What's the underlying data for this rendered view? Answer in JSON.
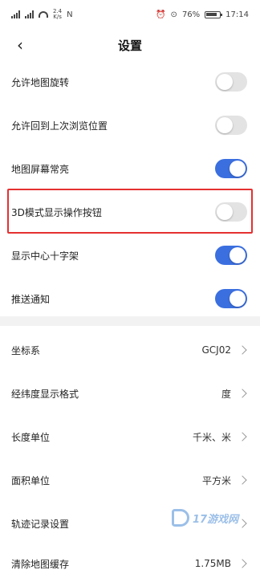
{
  "status_bar": {
    "net_speed_top": "2.4",
    "net_speed_bottom": "K/s",
    "battery": "76%",
    "time": "17:14",
    "icons": [
      "signal-icon",
      "wifi-icon",
      "nfc-icon",
      "alarm-icon",
      "location-icon",
      "battery-icon"
    ]
  },
  "header": {
    "title": "设置",
    "back_icon": "chevron-left-icon"
  },
  "toggles": [
    {
      "label": "允许地图旋转",
      "on": false
    },
    {
      "label": "允许回到上次浏览位置",
      "on": false
    },
    {
      "label": "地图屏幕常亮",
      "on": true
    },
    {
      "label": "3D模式显示操作按钮",
      "on": false
    },
    {
      "label": "显示中心十字架",
      "on": true
    },
    {
      "label": "推送通知",
      "on": true
    }
  ],
  "settings": [
    {
      "label": "坐标系",
      "value": "GCJ02"
    },
    {
      "label": "经纬度显示格式",
      "value": "度"
    },
    {
      "label": "长度单位",
      "value": "千米、米"
    },
    {
      "label": "面积单位",
      "value": "平方米"
    },
    {
      "label": "轨迹记录设置",
      "value": ""
    },
    {
      "label": "清除地图缓存",
      "value": "1.75MB"
    }
  ],
  "watermark": {
    "text": "17游戏网"
  },
  "colors": {
    "accent": "#3b6fe0",
    "toggle_off": "#e3e3e3",
    "highlight": "#e53030"
  }
}
